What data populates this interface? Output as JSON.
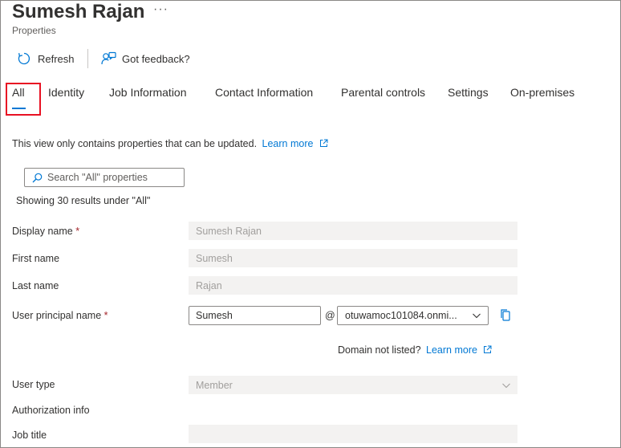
{
  "header": {
    "title": "Sumesh Rajan",
    "more_glyph": "···",
    "subtitle": "Properties"
  },
  "toolbar": {
    "refresh_label": "Refresh",
    "feedback_label": "Got feedback?",
    "refresh_icon": "refresh-icon",
    "feedback_icon": "feedback-icon"
  },
  "tabs": [
    {
      "label": "All",
      "selected": true
    },
    {
      "label": "Identity"
    },
    {
      "label": "Job Information"
    },
    {
      "label": "Contact Information"
    },
    {
      "label": "Parental controls"
    },
    {
      "label": "Settings"
    },
    {
      "label": "On-premises"
    }
  ],
  "info": {
    "text": "This view only contains properties that can be updated.",
    "link": "Learn more"
  },
  "search": {
    "placeholder": "Search \"All\" properties",
    "results_text": "Showing 30 results under \"All\""
  },
  "fields": {
    "display_name": {
      "label": "Display name",
      "required": "*",
      "value": "Sumesh Rajan"
    },
    "first_name": {
      "label": "First name",
      "value": "Sumesh"
    },
    "last_name": {
      "label": "Last name",
      "value": "Rajan"
    },
    "upn": {
      "label": "User principal name",
      "required": "*",
      "value": "Sumesh",
      "at": "@",
      "domain": "otuwamoc101084.onmi..."
    },
    "domain_note": {
      "text": "Domain not listed?",
      "link": "Learn more"
    },
    "user_type": {
      "label": "User type",
      "value": "Member"
    },
    "authorization_info": {
      "label": "Authorization info"
    },
    "job_title": {
      "label": "Job title",
      "value": ""
    }
  },
  "colors": {
    "accent": "#0078d4",
    "highlight_box": "#e81123",
    "required": "#a4262c"
  }
}
